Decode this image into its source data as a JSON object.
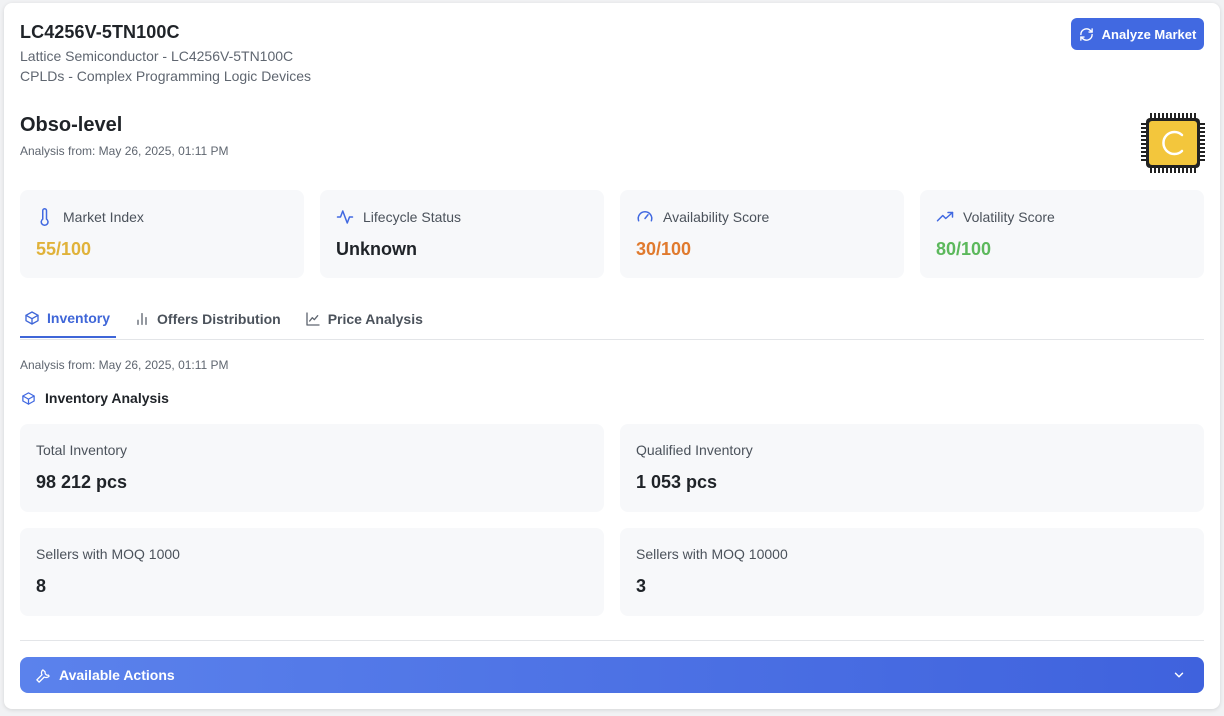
{
  "header": {
    "part_number": "LC4256V-5TN100C",
    "manufacturer_line": "Lattice Semiconductor - LC4256V-5TN100C",
    "category_line": "CPLDs - Complex Programming Logic Devices",
    "analyze_button": "Analyze Market"
  },
  "summary": {
    "level": "Obso-level",
    "analysis_date": "Analysis from: May 26, 2025, 01:11 PM"
  },
  "metrics": [
    {
      "label": "Market Index",
      "value": "55/100",
      "icon": "thermometer-icon",
      "color": "#e0b23a"
    },
    {
      "label": "Lifecycle Status",
      "value": "Unknown",
      "icon": "activity-icon",
      "color": "#1f2328"
    },
    {
      "label": "Availability Score",
      "value": "30/100",
      "icon": "gauge-icon",
      "color": "#e07a2e"
    },
    {
      "label": "Volatility Score",
      "value": "80/100",
      "icon": "trending-up-icon",
      "color": "#5cb85c"
    }
  ],
  "tabs": [
    {
      "label": "Inventory",
      "icon": "box-icon",
      "active": true
    },
    {
      "label": "Offers Distribution",
      "icon": "bar-chart-icon",
      "active": false
    },
    {
      "label": "Price Analysis",
      "icon": "line-chart-icon",
      "active": false
    }
  ],
  "inventory": {
    "analysis_date": "Analysis from: May 26, 2025, 01:11 PM",
    "section_title": "Inventory Analysis",
    "cards": [
      {
        "label": "Total Inventory",
        "value": "98 212 pcs"
      },
      {
        "label": "Qualified Inventory",
        "value": "1 053 pcs"
      },
      {
        "label": "Sellers with MOQ 1000",
        "value": "8"
      },
      {
        "label": "Sellers with MOQ 10000",
        "value": "3"
      }
    ]
  },
  "actions": {
    "label": "Available Actions"
  },
  "colors": {
    "accent": "#4169e1",
    "chip": "#f3c63c"
  }
}
